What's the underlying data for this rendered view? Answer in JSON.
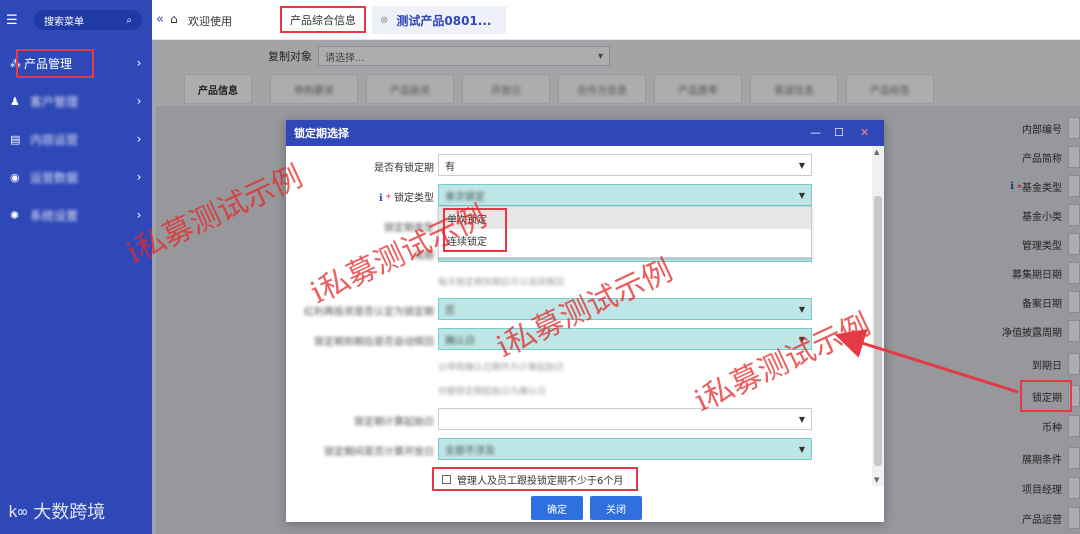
{
  "sidebar": {
    "search_label": "搜索菜单",
    "items": [
      {
        "label": "产品管理",
        "highlighted": true
      },
      {
        "label": "客户管理",
        "blurred": true
      },
      {
        "label": "内容运营",
        "blurred": true
      },
      {
        "label": "运营数据",
        "blurred": true
      },
      {
        "label": "系统设置",
        "blurred": true
      }
    ],
    "logo_text": "大数跨境"
  },
  "tabbar": {
    "welcome": "欢迎使用",
    "product_info_tab": "产品综合信息",
    "test_tab": "测试产品0801..."
  },
  "copy": {
    "label": "复制对象",
    "placeholder": "请选择..."
  },
  "subtabs": [
    "产品信息",
    "申购要求",
    "产品投资",
    "开放日",
    "合作方信息",
    "产品费率",
    "渠道信息",
    "产品标签"
  ],
  "right_fields": [
    {
      "label": "内部编号"
    },
    {
      "label": "产品简称"
    },
    {
      "label": "基金类型",
      "star": true,
      "info": true
    },
    {
      "label": "基金小类"
    },
    {
      "label": "管理类型"
    },
    {
      "label": "募集期日期"
    },
    {
      "label": "备案日期"
    },
    {
      "label": "净值披露周期"
    },
    {
      "label": "到期日"
    },
    {
      "label": "锁定期",
      "highlighted": true
    },
    {
      "label": "币种"
    },
    {
      "label": "展期条件"
    },
    {
      "label": "项目经理"
    },
    {
      "label": "产品运营"
    }
  ],
  "modal": {
    "title": "锁定期选择",
    "rows": [
      {
        "label": "是否有锁定期",
        "value": "有"
      },
      {
        "label": "锁定类型",
        "value": "单次锁定",
        "star": true,
        "info": true,
        "teal": true
      }
    ],
    "dropdown_options": [
      "单次锁定",
      "连续锁定"
    ],
    "blurred_labels": [
      "锁定期类型",
      "周期",
      "红利再投资是否认定为锁定期",
      "锁定期到期后是否自动赎回",
      "锁定期计算起始日",
      "锁定期间是否计算开放日"
    ],
    "blurred_values": [
      "否",
      "确认日",
      "全部不涉及"
    ],
    "blurred_notes": [
      "每次锁定期到期后可以选择赎回",
      "以申购确认日期作为计算起始日",
      "份额锁定期起始日为确认日"
    ],
    "checkbox_label": "管理人及员工跟投锁定期不少于6个月",
    "confirm": "确定",
    "close": "关闭"
  },
  "watermark": "i私募测试示例",
  "colors": {
    "sidebar": "#2f48b7",
    "accent": "#2f6fe0",
    "highlight": "#e63946",
    "teal": "#bfe6e6"
  }
}
